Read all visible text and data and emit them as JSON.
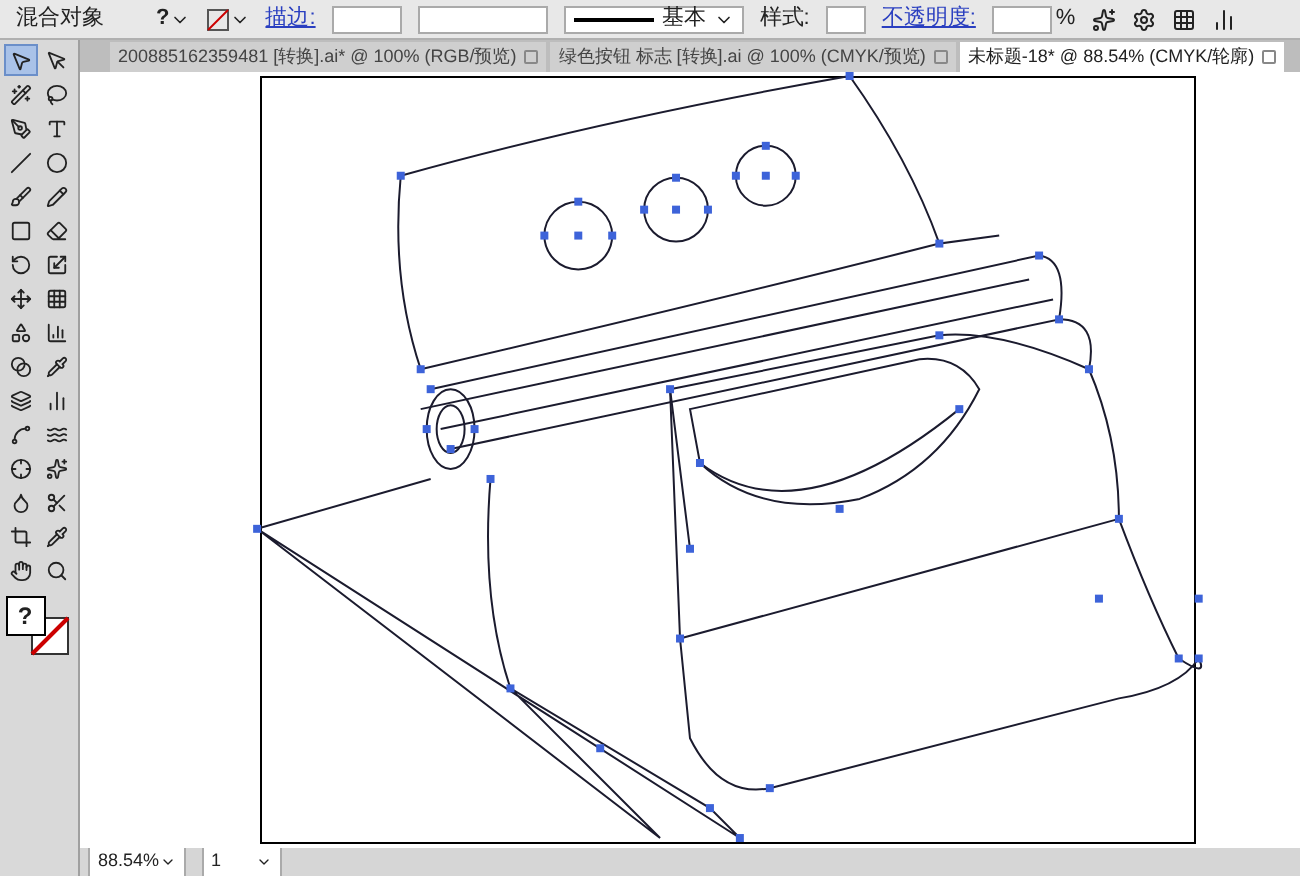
{
  "control_bar": {
    "selection_label": "混合对象",
    "fill_symbol": "?",
    "stroke_label": "描边:",
    "stroke_profile": "基本",
    "style_label": "样式:",
    "opacity_label": "不透明度:",
    "opacity_unit": "%"
  },
  "tabs": [
    {
      "label": "200885162359481 [转换].ai* @ 100% (RGB/预览)",
      "selected": false
    },
    {
      "label": "绿色按钮 标志 [转换].ai @ 100% (CMYK/预览)",
      "selected": false
    },
    {
      "label": "未标题-18* @ 88.54% (CMYK/轮廓)",
      "selected": true
    }
  ],
  "toolbox": {
    "fill_symbol": "?",
    "tools": [
      {
        "selected": true
      },
      {
        "selected": false
      },
      {
        "selected": false
      },
      {
        "selected": false
      },
      {
        "selected": false
      },
      {
        "selected": false
      },
      {
        "selected": false
      },
      {
        "selected": false
      },
      {
        "selected": false
      },
      {
        "selected": false
      },
      {
        "selected": false
      },
      {
        "selected": false
      },
      {
        "selected": false
      },
      {
        "selected": false
      },
      {
        "selected": false
      },
      {
        "selected": false
      },
      {
        "selected": false
      },
      {
        "selected": false
      },
      {
        "selected": false
      },
      {
        "selected": false
      },
      {
        "selected": false
      },
      {
        "selected": false
      },
      {
        "selected": false
      },
      {
        "selected": false
      },
      {
        "selected": false
      },
      {
        "selected": false
      },
      {
        "selected": false
      },
      {
        "selected": false
      },
      {
        "selected": false
      },
      {
        "selected": false
      },
      {
        "selected": false
      },
      {
        "selected": false
      }
    ]
  },
  "status_bar": {
    "zoom": "88.54%",
    "page": "1"
  }
}
